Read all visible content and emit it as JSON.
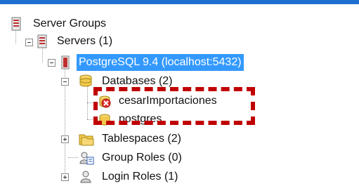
{
  "tree": {
    "server_groups": {
      "label": "Server Groups",
      "icon": "server-group-icon"
    },
    "servers": {
      "label": "Servers (1)",
      "icon": "server-stack-icon"
    },
    "postgres": {
      "label": "PostgreSQL 9.4 (localhost:5432)",
      "icon": "server-icon"
    },
    "databases": {
      "label": "Databases (2)",
      "icon": "database-stack-icon"
    },
    "db_items": [
      {
        "label": "cesarImportaciones",
        "icon": "database-error-icon"
      },
      {
        "label": "postgres",
        "icon": "database-icon"
      }
    ],
    "tablespaces": {
      "label": "Tablespaces (2)",
      "icon": "tablespaces-icon"
    },
    "group_roles": {
      "label": "Group Roles (0)",
      "icon": "group-roles-icon"
    },
    "login_roles": {
      "label": "Login Roles (1)",
      "icon": "login-roles-icon"
    }
  },
  "colors": {
    "selection": "#3399ff",
    "highlight": "#c00000",
    "topbar": "#1e6fd0"
  }
}
